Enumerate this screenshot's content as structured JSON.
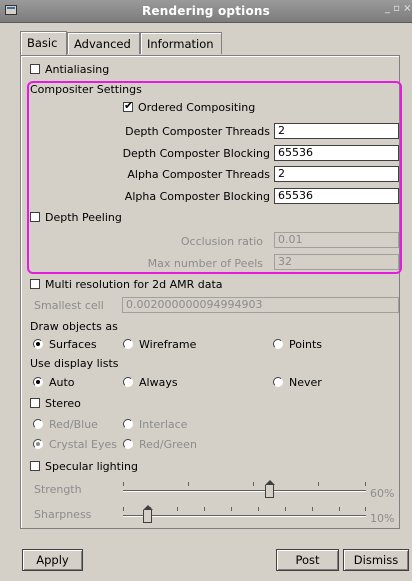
{
  "window": {
    "title": "Rendering options",
    "controls": "_ ▫ ×"
  },
  "tabs": [
    "Basic",
    "Advanced",
    "Information"
  ],
  "antialiasing": {
    "label": "Antialiasing",
    "checked": false
  },
  "compositor": {
    "heading": "Compositer Settings",
    "ordered": {
      "label": "Ordered Compositing",
      "checked": true
    },
    "depth_threads": {
      "label": "Depth Composter Threads",
      "value": "2"
    },
    "depth_blocking": {
      "label": "Depth Composter Blocking",
      "value": "65536"
    },
    "alpha_threads": {
      "label": "Alpha Composter Threads",
      "value": "2"
    },
    "alpha_blocking": {
      "label": "Alpha Composter Blocking",
      "value": "65536"
    }
  },
  "depth_peeling": {
    "label": "Depth Peeling",
    "checked": false,
    "occlusion": {
      "label": "Occlusion ratio",
      "value": "0.01"
    },
    "peels": {
      "label": "Max number of Peels",
      "value": "32"
    }
  },
  "amr": {
    "label": "Multi resolution for 2d AMR data",
    "checked": false,
    "smallest": {
      "label": "Smallest cell",
      "value": "0.002000000094994903"
    }
  },
  "draw_as": {
    "heading": "Draw objects as",
    "options": [
      "Surfaces",
      "Wireframe",
      "Points"
    ],
    "selected": "Surfaces"
  },
  "display_lists": {
    "heading": "Use display lists",
    "options": [
      "Auto",
      "Always",
      "Never"
    ],
    "selected": "Auto"
  },
  "stereo": {
    "label": "Stereo",
    "checked": false,
    "options": [
      "Red/Blue",
      "Interlace",
      "Crystal Eyes",
      "Red/Green"
    ],
    "selected": "Crystal Eyes"
  },
  "specular": {
    "label": "Specular lighting",
    "checked": false,
    "strength": {
      "label": "Strength",
      "value_text": "60%",
      "value": 0.6
    },
    "sharpness": {
      "label": "Sharpness",
      "value_text": "10%",
      "value": 0.1
    }
  },
  "buttons": {
    "apply": "Apply",
    "post": "Post",
    "dismiss": "Dismiss"
  },
  "colors": {
    "highlight": "#e71be0",
    "background": "#d4d0c8"
  }
}
